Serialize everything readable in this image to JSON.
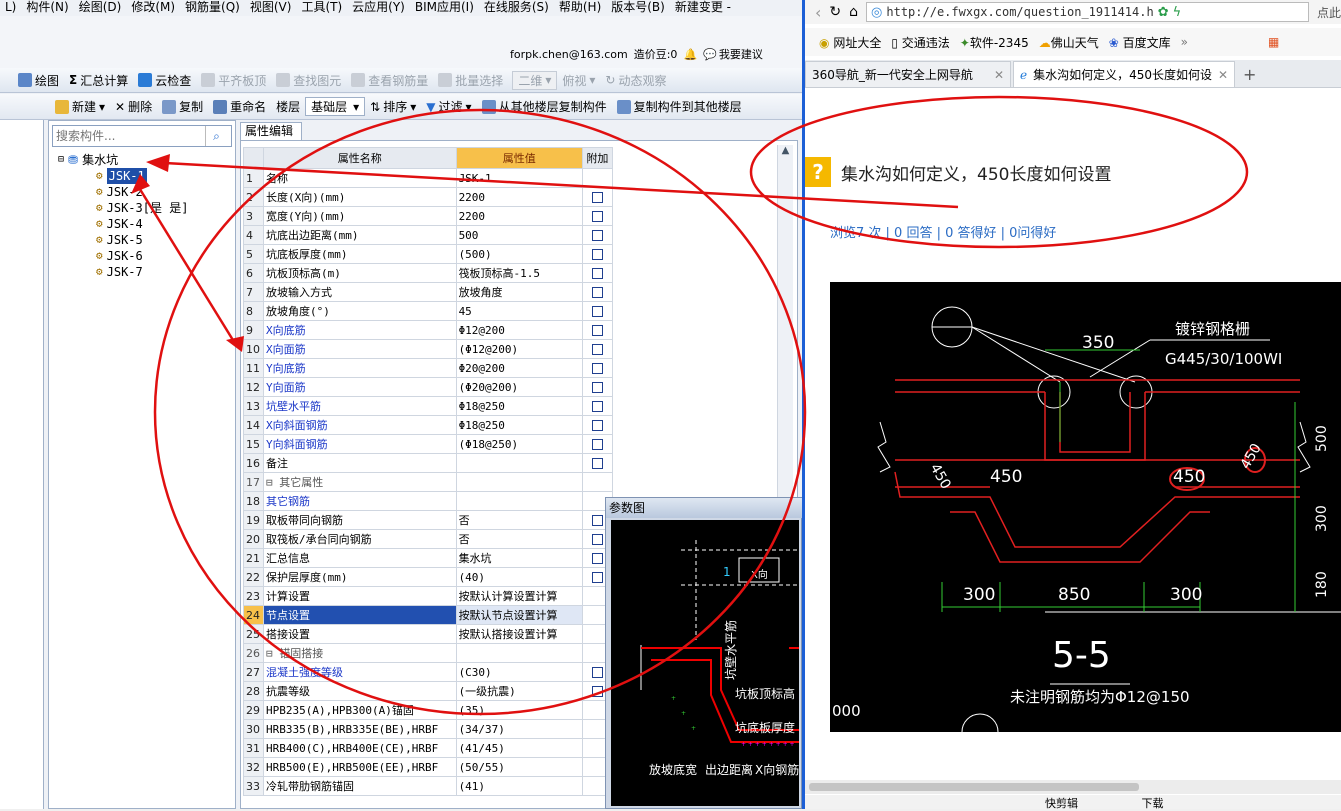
{
  "menu": {
    "items": [
      "L)",
      "构件(N)",
      "绘图(D)",
      "修改(M)",
      "钢筋量(Q)",
      "视图(V)",
      "工具(T)",
      "云应用(Y)",
      "BIM应用(I)",
      "在线服务(S)",
      "帮助(H)",
      "版本号(B)",
      "新建变更 -"
    ]
  },
  "account": {
    "email": "forpk.chen@163.com",
    "douzi": "造价豆:0",
    "suggest": "我要建议"
  },
  "toolbar1": {
    "items": [
      "绘图",
      "汇总计算",
      "云检查",
      "平齐板顶",
      "查找图元",
      "查看钢筋量",
      "批量选择",
      "二维",
      "俯视",
      "动态观察"
    ]
  },
  "toolbar2": {
    "new": "新建",
    "delete": "删除",
    "copy": "复制",
    "rename": "重命名",
    "floor": "楼层",
    "floor_value": "基础层",
    "sort": "排序",
    "filter": "过滤",
    "copy_from": "从其他楼层复制构件",
    "copy_to": "复制构件到其他楼层"
  },
  "search": {
    "placeholder": "搜索构件..."
  },
  "tree": {
    "root": "集水坑",
    "children": [
      "JSK-1",
      "JSK-2",
      "JSK-3[是 是]",
      "JSK-4",
      "JSK-5",
      "JSK-6",
      "JSK-7"
    ],
    "selected": "JSK-1"
  },
  "props": {
    "tab": "属性编辑",
    "headers": [
      "属性名称",
      "属性值",
      "附加"
    ],
    "rows": [
      {
        "no": "1",
        "name": "名称",
        "value": "JSK-1",
        "blue": false,
        "check": false
      },
      {
        "no": "2",
        "name": "长度(X向)(mm)",
        "value": "2200",
        "blue": false,
        "check": true
      },
      {
        "no": "3",
        "name": "宽度(Y向)(mm)",
        "value": "2200",
        "blue": false,
        "check": true
      },
      {
        "no": "4",
        "name": "坑底出边距离(mm)",
        "value": "500",
        "blue": false,
        "check": true
      },
      {
        "no": "5",
        "name": "坑底板厚度(mm)",
        "value": "(500)",
        "blue": false,
        "check": true
      },
      {
        "no": "6",
        "name": "坑板顶标高(m)",
        "value": "筏板顶标高-1.5",
        "blue": false,
        "check": true
      },
      {
        "no": "7",
        "name": "放坡输入方式",
        "value": "放坡角度",
        "blue": false,
        "check": true
      },
      {
        "no": "8",
        "name": "放坡角度(°)",
        "value": "45",
        "blue": false,
        "check": true
      },
      {
        "no": "9",
        "name": "X向底筋",
        "value": "Φ12@200",
        "blue": true,
        "check": true
      },
      {
        "no": "10",
        "name": "X向面筋",
        "value": "(Φ12@200)",
        "blue": true,
        "check": true
      },
      {
        "no": "11",
        "name": "Y向底筋",
        "value": "Φ20@200",
        "blue": true,
        "check": true
      },
      {
        "no": "12",
        "name": "Y向面筋",
        "value": "(Φ20@200)",
        "blue": true,
        "check": true
      },
      {
        "no": "13",
        "name": "坑壁水平筋",
        "value": "Φ18@250",
        "blue": true,
        "check": true
      },
      {
        "no": "14",
        "name": "X向斜面钢筋",
        "value": "Φ18@250",
        "blue": true,
        "check": true
      },
      {
        "no": "15",
        "name": "Y向斜面钢筋",
        "value": "(Φ18@250)",
        "blue": true,
        "check": true
      },
      {
        "no": "16",
        "name": "备注",
        "value": "",
        "blue": false,
        "check": true
      },
      {
        "no": "17",
        "name": "⊟ 其它属性",
        "value": "",
        "blue": false,
        "check": false,
        "group": true
      },
      {
        "no": "18",
        "name": "  其它钢筋",
        "value": "",
        "blue": true,
        "check": false
      },
      {
        "no": "19",
        "name": "  取板带同向钢筋",
        "value": "否",
        "blue": false,
        "check": true
      },
      {
        "no": "20",
        "name": "  取筏板/承台同向钢筋",
        "value": "否",
        "blue": false,
        "check": true
      },
      {
        "no": "21",
        "name": "  汇总信息",
        "value": "集水坑",
        "blue": false,
        "check": true
      },
      {
        "no": "22",
        "name": "  保护层厚度(mm)",
        "value": "(40)",
        "blue": false,
        "check": true
      },
      {
        "no": "23",
        "name": "  计算设置",
        "value": "按默认计算设置计算",
        "blue": false,
        "check": false
      },
      {
        "no": "24",
        "name": "  节点设置",
        "value": "按默认节点设置计算",
        "blue": false,
        "check": false,
        "selected": true
      },
      {
        "no": "25",
        "name": "  搭接设置",
        "value": "按默认搭接设置计算",
        "blue": false,
        "check": false
      },
      {
        "no": "26",
        "name": "⊟ 锚固搭接",
        "value": "",
        "blue": false,
        "check": false,
        "group": true
      },
      {
        "no": "27",
        "name": "  混凝土强度等级",
        "value": "(C30)",
        "blue": true,
        "check": true
      },
      {
        "no": "28",
        "name": "  抗震等级",
        "value": "(一级抗震)",
        "blue": false,
        "check": true
      },
      {
        "no": "29",
        "name": "  HPB235(A),HPB300(A)锚固",
        "value": "(35)",
        "blue": false,
        "check": false
      },
      {
        "no": "30",
        "name": "  HRB335(B),HRB335E(BE),HRBF",
        "value": "(34/37)",
        "blue": false,
        "check": false
      },
      {
        "no": "31",
        "name": "  HRB400(C),HRB400E(CE),HRBF",
        "value": "(41/45)",
        "blue": false,
        "check": false
      },
      {
        "no": "32",
        "name": "  HRB500(E),HRB500E(EE),HRBF",
        "value": "(50/55)",
        "blue": false,
        "check": false
      },
      {
        "no": "33",
        "name": "  冷轧带肋钢筋锚固",
        "value": "(41)",
        "blue": false,
        "check": false
      }
    ]
  },
  "diagram": {
    "title": "参数图",
    "labels": [
      "坑壁水平筋",
      "坑板顶标高",
      "坑底板厚度",
      "放坡底宽",
      "出边距离",
      "X向钢筋",
      "X向",
      "1"
    ]
  },
  "browser": {
    "url": "http://e.fwxgx.com/question_1911414.h",
    "bookmarks": [
      "网址大全",
      "交通违法",
      "软件-2345",
      "佛山天气",
      "百度文库"
    ],
    "tabs": [
      "360导航_新一代安全上网导航",
      "集水沟如何定义，450长度如何设"
    ],
    "question_title": "集水沟如何定义，450长度如何设置",
    "stats": "浏览7 次 | 0 回答 | 0 答得好 | 0问得好",
    "right_edge": "点此",
    "status": [
      "快剪辑",
      "下载"
    ]
  },
  "cad": {
    "labels": [
      "350",
      "镀锌钢格栅",
      "G445/30/100WI",
      "450",
      "450",
      "450",
      "450",
      "300",
      "850",
      "300",
      "5-5",
      "未注明钢筋均为Φ12@150",
      "500",
      "300",
      "180",
      "000"
    ]
  },
  "colors": {
    "accent": "#f7c04a",
    "selection": "#2250b0",
    "annotation": "#e01010",
    "cad_bg": "#000000"
  }
}
